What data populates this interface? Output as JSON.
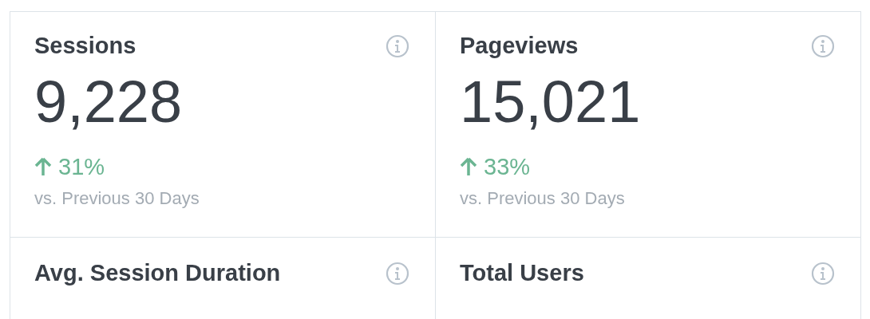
{
  "cards": [
    {
      "title": "Sessions",
      "value": "9,228",
      "change": {
        "rising": true,
        "text": "31%"
      },
      "comparison": "vs. Previous 30 Days"
    },
    {
      "title": "Pageviews",
      "value": "15,021",
      "change": {
        "rising": true,
        "text": "33%"
      },
      "comparison": "vs. Previous 30 Days"
    },
    {
      "title": "Avg. Session Duration"
    },
    {
      "title": "Total Users"
    }
  ]
}
